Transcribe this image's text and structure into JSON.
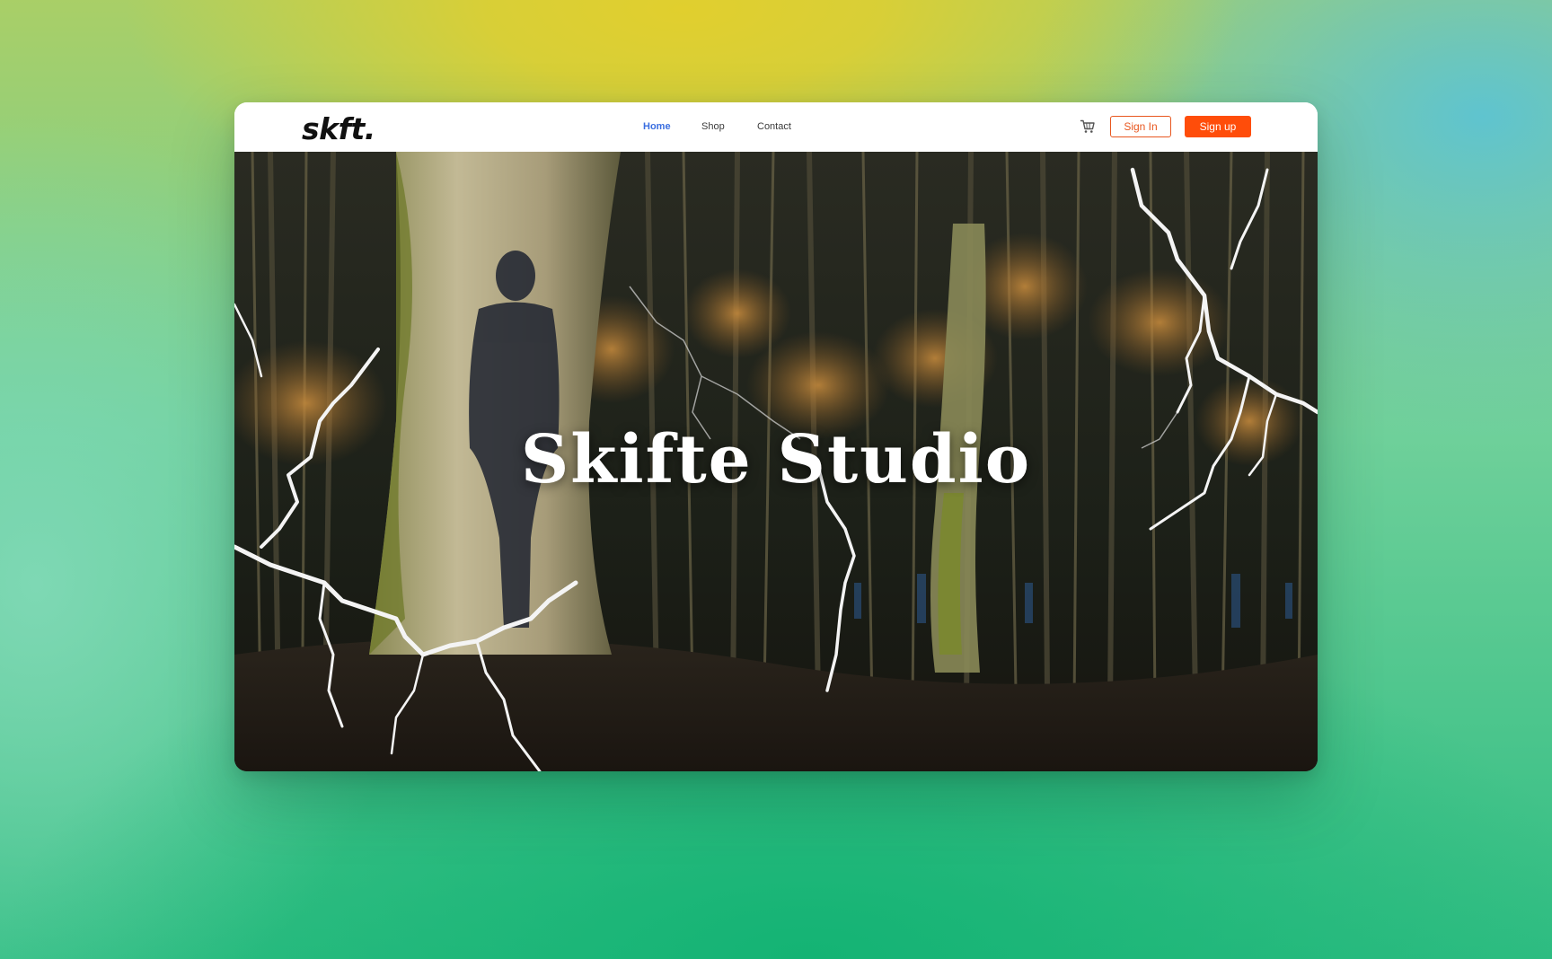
{
  "brand": {
    "logo": "skft."
  },
  "nav": {
    "links": [
      {
        "label": "Home",
        "active": true
      },
      {
        "label": "Shop",
        "active": false
      },
      {
        "label": "Contact",
        "active": false
      }
    ]
  },
  "actions": {
    "cart_icon": "cart-icon",
    "sign_in_label": "Sign In",
    "sign_up_label": "Sign up"
  },
  "hero": {
    "title": "Skifte Studio",
    "image": "forest-silhouette-lightning"
  },
  "colors": {
    "accent": "#ff4d0a",
    "nav_active": "#3a6ee0",
    "text_dark": "#111111"
  }
}
